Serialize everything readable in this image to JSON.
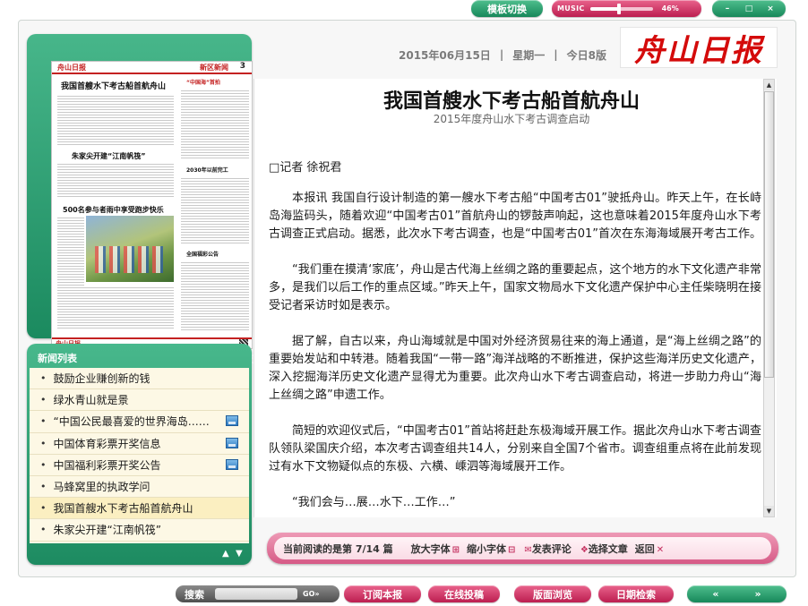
{
  "top": {
    "template_switch": "模板切换",
    "music_label": "MUSIC",
    "music_level": 0.46,
    "music_percent": "46%",
    "window_controls": [
      "–",
      "□",
      "×"
    ]
  },
  "header": {
    "date": "2015年06月15日",
    "weekday": "星期一",
    "edition": "今日8版",
    "masthead": "舟山日报"
  },
  "thumbnail": {
    "logo": "舟山日报",
    "section": "新区新闻",
    "page_no": "3",
    "headline_main": "我国首艘水下考古船首航舟山",
    "headline_2": "朱家尖开建“江南帆筏”",
    "headline_3": "500名参与者雨中享受跑步快乐",
    "side_heads": [
      "“中国海”首拍",
      "2030年以前完工",
      "全国福彩公告"
    ],
    "footer_logo": "舟山日报",
    "refresh_icon": "refresh-icon"
  },
  "news": {
    "title": "新闻列表",
    "items": [
      {
        "label": "鼓励企业赚创新的钱",
        "icon": false
      },
      {
        "label": "绿水青山就是景",
        "icon": false
      },
      {
        "label": "“中国公民最喜爱的世界海岛……",
        "icon": true
      },
      {
        "label": "中国体育彩票开奖信息",
        "icon": true
      },
      {
        "label": "中国福利彩票开奖公告",
        "icon": true
      },
      {
        "label": "马蜂窝里的执政学问",
        "icon": false
      },
      {
        "label": "我国首艘水下考古船首航舟山",
        "icon": false
      },
      {
        "label": "朱家尖开建“江南帆筏”",
        "icon": false
      }
    ],
    "up": "▲",
    "down": "▼"
  },
  "article": {
    "title": "我国首艘水下考古船首航舟山",
    "subtitle": "2015年度舟山水下考古调查启动",
    "byline": "□记者  徐祝君",
    "paragraphs": [
      "本报讯  我国自行设计制造的第一艘水下考古船“中国考古01”驶抵舟山。昨天上午，在长峙岛海监码头，随着欢迎“中国考古01”首航舟山的锣鼓声响起，这也意味着2015年度舟山水下考古调查正式启动。据悉，此次水下考古调查，也是“中国考古01”首次在东海海域展开考古工作。",
      "“我们重在摸清‘家底’，舟山是古代海上丝绸之路的重要起点，这个地方的水下文化遗产非常多，是我们以后工作的重点区域。”昨天上午，国家文物局水下文化遗产保护中心主任柴晓明在接受记者采访时如是表示。",
      "据了解，自古以来，舟山海域就是中国对外经济贸易往来的海上通道，是“海上丝绸之路”的重要始发站和中转港。随着我国“一带一路”海洋战略的不断推进，保护这些海洋历史文化遗产，深入挖掘海洋历史文化遗产显得尤为重要。此次舟山水下考古调查启动，将进一步助力舟山“海上丝绸之路”申遗工作。",
      "简短的欢迎仪式后，“中国考古01”首站将赶赴东极海域开展工作。据此次舟山水下考古调查队领队梁国庆介绍，本次考古调查组共14人，分别来自全国7个省市。调查组重点将在此前发现过有水下文物疑似点的东极、六横、嵊泗等海域展开工作。",
      "“我们会与…展…水下…工作…”"
    ]
  },
  "reading_bar": {
    "status": "当前阅读的是第 7/14 篇",
    "enlarge": "放大字体",
    "shrink": "缩小字体",
    "comment": "发表评论",
    "select": "选择文章",
    "back": "返回"
  },
  "bottom": {
    "search_label": "搜索",
    "search_value": "",
    "search_go": "GO»",
    "subscribe": "订阅本报",
    "submit": "在线投稿",
    "browse": "版面浏览",
    "date_search": "日期检索",
    "prev": "«",
    "next": "»"
  }
}
